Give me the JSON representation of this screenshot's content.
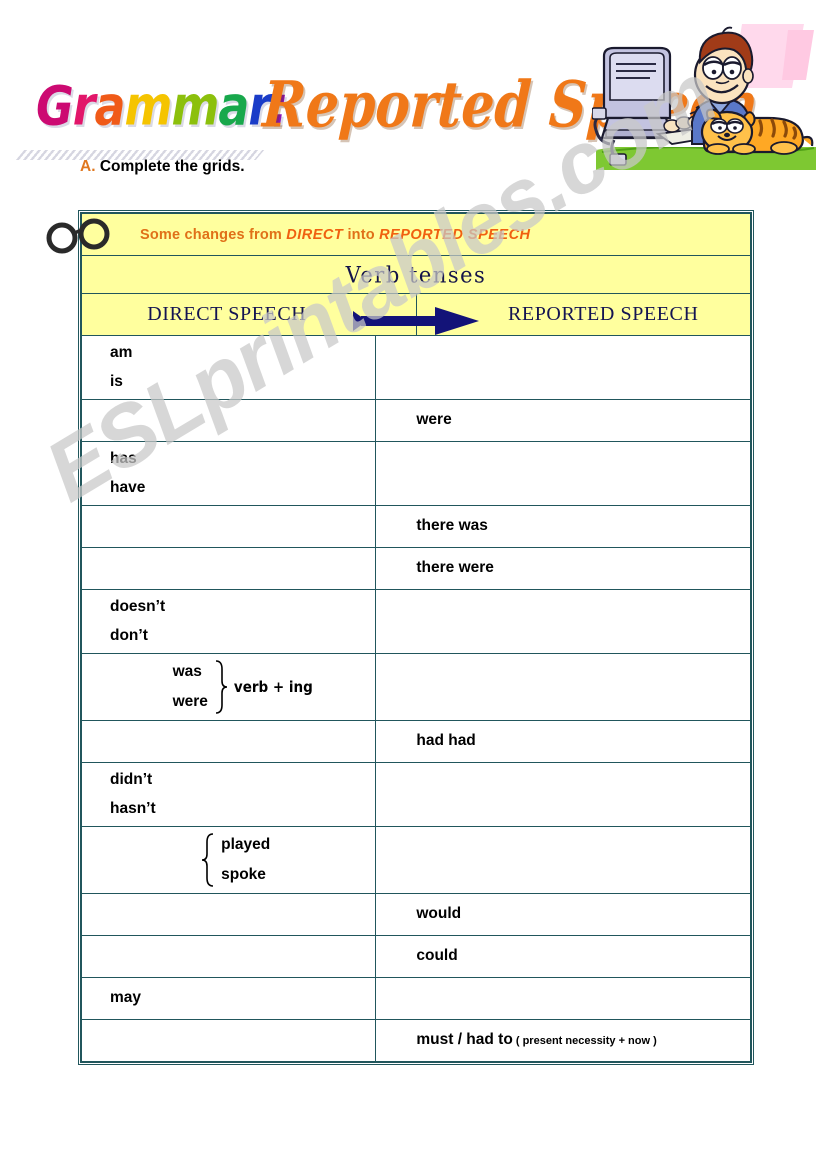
{
  "page": {
    "watermark": "ESLprintables.com"
  },
  "title": {
    "word1_letters": [
      {
        "ch": "G",
        "color": "#cc0a72"
      },
      {
        "ch": "r",
        "color": "#e2166a"
      },
      {
        "ch": "a",
        "color": "#f05a18"
      },
      {
        "ch": "m",
        "color": "#f5c400"
      },
      {
        "ch": "m",
        "color": "#8cc00c"
      },
      {
        "ch": "a",
        "color": "#18a84c"
      },
      {
        "ch": "r",
        "color": "#1a3cc8"
      },
      {
        "ch": ":",
        "color": "#8a14b4"
      }
    ],
    "word1": "Grammar:",
    "word2": "Reported Speech",
    "word2_color": "#f07818",
    "clipart_name": "garfield-at-computer"
  },
  "instruction": {
    "letter": "A.",
    "letter_color": "#e07820",
    "text": "Complete the grids."
  },
  "grid": {
    "banner": {
      "part1": "Some changes from ",
      "em1": "DIRECT",
      "part2": " into  ",
      "em2": "REPORTED SPEECH",
      "color": "#e07018",
      "bg": "#ffff9e"
    },
    "subtitle": "Verb tenses",
    "columns": {
      "left": "DIRECT SPEECH",
      "right": "REPORTED SPEECH",
      "arrow_color": "#131378"
    },
    "rows": [
      {
        "direct": [
          "am",
          "is"
        ],
        "reported": [],
        "brace": "none",
        "annotation": ""
      },
      {
        "direct": [],
        "reported": [
          "were"
        ],
        "brace": "none",
        "annotation": ""
      },
      {
        "direct": [
          "has",
          "have"
        ],
        "reported": [],
        "brace": "none",
        "annotation": ""
      },
      {
        "direct": [],
        "reported": [
          "there was"
        ],
        "brace": "none",
        "annotation": ""
      },
      {
        "direct": [],
        "reported": [
          "there were"
        ],
        "brace": "none",
        "annotation": ""
      },
      {
        "direct": [
          "doesn’t",
          "don’t"
        ],
        "reported": [],
        "brace": "none",
        "annotation": ""
      },
      {
        "direct": [
          "was",
          "were"
        ],
        "reported": [],
        "brace": "right",
        "annotation": "verb + ing"
      },
      {
        "direct": [],
        "reported": [
          "had had"
        ],
        "brace": "none",
        "annotation": ""
      },
      {
        "direct": [
          "didn’t",
          "hasn’t"
        ],
        "reported": [],
        "brace": "none",
        "annotation": ""
      },
      {
        "direct": [
          "played",
          "spoke"
        ],
        "reported": [],
        "brace": "left",
        "annotation": ""
      },
      {
        "direct": [],
        "reported": [
          "would"
        ],
        "brace": "none",
        "annotation": ""
      },
      {
        "direct": [],
        "reported": [
          "could"
        ],
        "brace": "none",
        "annotation": ""
      },
      {
        "direct": [
          "may"
        ],
        "reported": [],
        "brace": "none",
        "annotation": ""
      },
      {
        "direct": [],
        "reported": [
          "must / had to"
        ],
        "reported_note": "( present necessity + now )",
        "brace": "none",
        "annotation": ""
      }
    ]
  }
}
